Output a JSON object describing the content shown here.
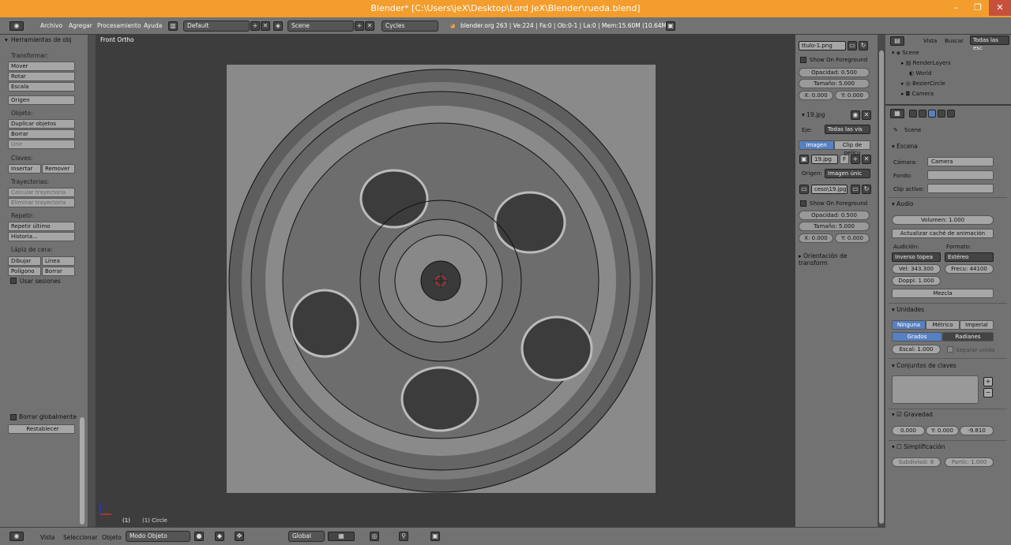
{
  "window": {
    "title": "Blender* [C:\\Users\\jeX\\Desktop\\Lord JeX\\Blender\\rueda.blend]",
    "minimize": "–",
    "maximize": "❐",
    "close": "✕"
  },
  "infobar": {
    "menus": [
      "Archivo",
      "Agregar",
      "Procesamiento",
      "Ayuda"
    ],
    "screen_layout": "Default",
    "scene": "Scene",
    "engine": "Cycles",
    "stats": "blender.org 263 | Ve:224 | Fa:0 | Ob:0-1 | La:0 | Mem:15.60M (10.64M)"
  },
  "toolshelf": {
    "panel_title": "Herramientas de obj",
    "transformar_label": "Transformar:",
    "mover": "Mover",
    "rotar": "Rotar",
    "escala": "Escala",
    "origen": "Origen",
    "objeto_label": "Objeto:",
    "duplicar": "Duplicar objetos",
    "borrar": "Borrar",
    "unir": "Unir",
    "claves_label": "Claves:",
    "insertar": "Insertar",
    "remover": "Remover",
    "trayectorias_label": "Trayectorias:",
    "calcular": "Calcular trayectoria",
    "eliminar": "Eliminar trayectoria",
    "repetir_label": "Repetir:",
    "repetir_ultimo": "Repetir último",
    "historia": "Historia...",
    "lapiz_label": "Lápiz de cera:",
    "dibujar": "Dibujar",
    "linea": "Línea",
    "poligono": "Polígono",
    "borrar2": "Borrar",
    "usar_sesiones": "Usar sesiones",
    "borrar_globalmente": "Borrar globalmente",
    "restablecer": "Restablecer"
  },
  "viewport": {
    "view_name": "Front Ortho",
    "object_label": "(1) Circle",
    "frame": "(1)"
  },
  "npanel": {
    "img1_name": "ttulo-1.png",
    "show_on_foreground": "Show On Foreground",
    "opacidad1": "Opacidad: 0.500",
    "tamano1": "Tamaño: 5.000",
    "x1": "X: 0.000",
    "y1": "Y: 0.000",
    "img2_title": "19.jpg",
    "eje_label": "Eje:",
    "eje_value": "Todas las vis",
    "imagen_tab": "Imagen",
    "clip_tab": "Clip de pelícu",
    "img2_file": "19.jpg",
    "f_label": "F",
    "origen_label": "Origen:",
    "origen_value": "Imagen únic",
    "path_value": "ceso\\19.jpg",
    "show_on_foreground2": "Show On Foreground",
    "opacidad2": "Opacidad: 0.500",
    "tamano2": "Tamaño: 5.000",
    "x2": "X: 0.000",
    "y2": "Y: 0.000",
    "orientacion": "Orientación de transform"
  },
  "outliner": {
    "menus": [
      "Vista",
      "Buscar"
    ],
    "filter": "Todas las esc",
    "items": [
      "Scene",
      "RenderLayers",
      "World",
      "BezierCircle",
      "Camera"
    ]
  },
  "properties": {
    "breadcrumb": "Scene",
    "escena_title": "Escena",
    "camara_label": "Cámara:",
    "camara_value": "Camera",
    "fondo_label": "Fondo:",
    "clip_label": "Clip activo:",
    "audio_title": "Audio",
    "volumen": "Volumen: 1.000",
    "actualizar_cache": "Actualizar caché de animación",
    "audicion_label": "Audición:",
    "formato_label": "Formato:",
    "audicion_value": "Inverso topea",
    "formato_value": "Estéreo",
    "vel": "Vel: 343.300",
    "frecu": "Frecu: 44100",
    "doppl": "Doppl: 1.000",
    "mezcla": "Mezcla",
    "unidades_title": "Unidades",
    "ninguna": "Ninguna",
    "metrico": "Métrico",
    "imperial": "Imperial",
    "grados": "Grados",
    "radianes": "Radianes",
    "escal": "Escal: 1.000",
    "separar": "Separar unida",
    "conjuntos_title": "Conjuntos de claves",
    "gravedad_title": "Gravedad",
    "gx": "0.000",
    "gy": "Y: 0.000",
    "gz": "-9.810",
    "simplificacion_title": "Simplificación",
    "subdivisio": "Subdivisió: 6",
    "partic": "Partíc: 1.000"
  },
  "bottombar": {
    "menus": [
      "Vista",
      "Seleccionar",
      "Objeto"
    ],
    "mode": "Modo Objeto",
    "orientation": "Global"
  }
}
